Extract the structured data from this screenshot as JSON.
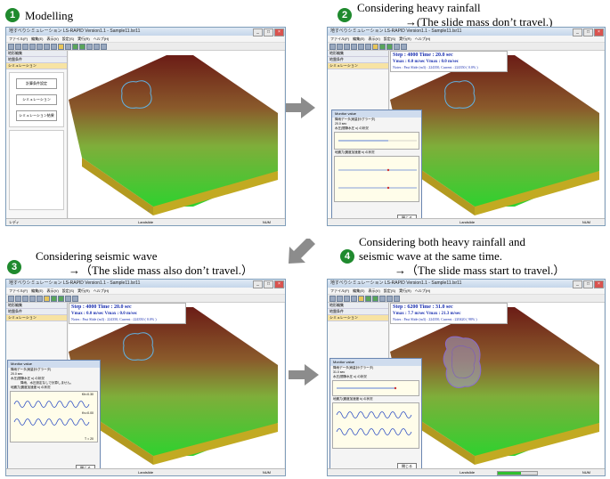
{
  "captions": {
    "c1": "Modelling",
    "c2_line1": "Considering heavy rainfall",
    "c2_line2": "→(The slide mass don’t travel.)",
    "c3_line1": "Considering seismic wave",
    "c3_line2": "→（The slide mass also don’t travel.）",
    "c4_line1": "Considering both heavy rainfall and",
    "c4_line2": "seismic wave at the same time.",
    "c4_line3": "→（The slide mass start to travel.）"
  },
  "step_numbers": [
    "1",
    "2",
    "3",
    "4"
  ],
  "window": {
    "title": "地すべりシミュレーション LS-RAPID Version1.1 - Sample11.lsr11",
    "menu": [
      "ファイル(F)",
      "編集(E)",
      "表示(V)",
      "設定(S)",
      "実行(R)",
      "ヘルプ(H)"
    ],
    "sidebar_headers": [
      "地形編集",
      "地盤条件",
      "シミュレーション"
    ],
    "sidebar_buttons": [
      "計算条件設定",
      "シミュレーション",
      "シミュレーション結果"
    ],
    "status_left": "レディ",
    "status_mid": "Landslide",
    "status_right": "NUM"
  },
  "panels": {
    "p2": {
      "step": "Step : 4000  Time : 20.0 sec",
      "vmax": "Vmax : 0.0 m/sec   Vmax : 0.0 m/sec",
      "notes": "Notes : Past Slide (m3) : 224350,  Current : 224350 ( 0.0% )"
    },
    "p3": {
      "step": "Step : 4000  Time : 20.0 sec",
      "vmax": "Vmax : 0.0 m/sec   Vmax : 0.0 m/sec",
      "notes": "Notes : Past Slide (m3) : 224350,  Current : 224350 ( 0.0% )"
    },
    "p4": {
      "step": "Step : 6200  Time : 31.0 sec",
      "vmax": "Vmax : 7.7 m/sec   Vmax : 21.3 m/sec",
      "notes": "Notes : Past Slide (m3) : 224350,  Current : 220420 ( 98% )"
    }
  },
  "monitor": {
    "title": "Monitor value",
    "rain_label": "降雨データ(雨量計/グラータ)",
    "p2_time": "20.0 sec",
    "p3_time": "20.0 sec",
    "p4_time": "31.0 sec",
    "pore_label": "水圧(間隙水圧 u) の状況",
    "no_rain_msg": "降雨、水圧設定なしで計算しません。",
    "seismic_label": "地震力(震度加速度 k) の状況",
    "kh_label": "Kh=0.30",
    "kv_label": "Kv=0.00",
    "t_label": "T = 20",
    "close": "閉じる"
  },
  "colors": {
    "accent_green": "#1f8a2e",
    "terrain_green": "#3bc23b",
    "info_blue": "#1a2fb0",
    "arrow_gray": "#8c8c8c"
  }
}
